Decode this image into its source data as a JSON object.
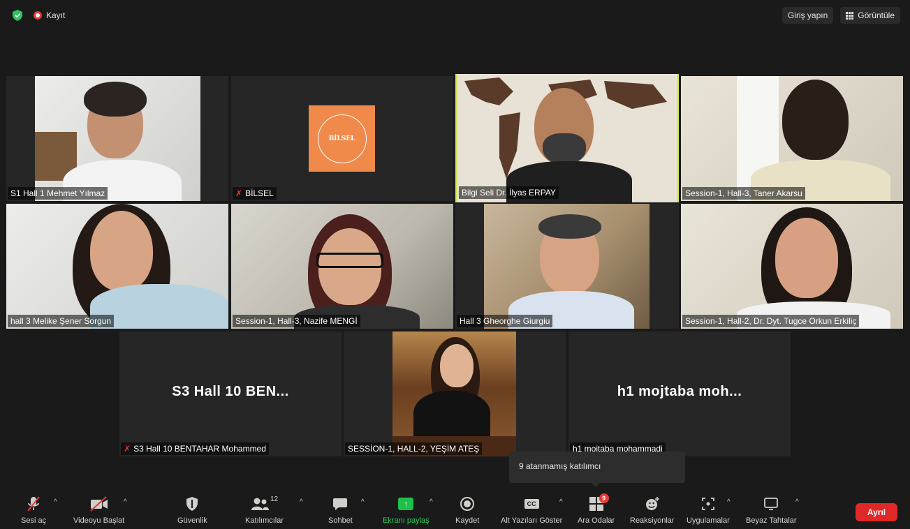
{
  "topbar": {
    "recording_label": "Kayıt",
    "sign_in_label": "Giriş yapın",
    "view_label": "Görüntüle"
  },
  "participants": [
    {
      "name": "S1 Hall 1 Mehmet Yılmaz",
      "muted": false,
      "video": true
    },
    {
      "name": "BİLSEL",
      "muted": true,
      "video": false,
      "logo_text": "BİLSEL"
    },
    {
      "name": "Bilgi Seli Dr. İlyas ERPAY",
      "muted": false,
      "video": true,
      "active_speaker": true
    },
    {
      "name": "Session-1, Hall-3, Taner Akarsu",
      "muted": false,
      "video": true
    },
    {
      "name": "hall 3 Melike Şener Sorgun",
      "muted": false,
      "video": true
    },
    {
      "name": "Session-1, Hall-3, Nazife MENGİ",
      "muted": false,
      "video": true
    },
    {
      "name": "Hall 3 Gheorghe Giurgiu",
      "muted": false,
      "video": true
    },
    {
      "name": "Session-1, Hall-2, Dr. Dyt. Tugce Orkun Erkiliç",
      "muted": false,
      "video": true
    },
    {
      "name": "S3  Hall 10  BENTAHAR Mohammed",
      "muted": true,
      "video": false,
      "display_name": "S3  Hall 10  BEN..."
    },
    {
      "name": "SESSİON-1, HALL-2, YEŞİM ATEŞ",
      "muted": false,
      "video": true
    },
    {
      "name": "h1 mojtaba mohammadi",
      "muted": false,
      "video": false,
      "display_name": "h1 mojtaba moh..."
    }
  ],
  "tooltip": {
    "text": "9 atanmamış katılımcı"
  },
  "toolbar": {
    "unmute": "Sesi aç",
    "start_video": "Videoyu Başlat",
    "security": "Güvenlik",
    "participants": "Katılımcılar",
    "participants_count": "12",
    "chat": "Sohbet",
    "share_screen": "Ekranı paylaş",
    "record": "Kaydet",
    "captions": "Alt Yazıları Göster",
    "captions_icon": "CC",
    "breakout_rooms": "Ara Odalar",
    "breakout_badge": "9",
    "reactions": "Reaksiyonlar",
    "apps": "Uygulamalar",
    "whiteboard": "Beyaz Tahtalar",
    "leave": "Ayrıl"
  },
  "colors": {
    "background": "#1a1a1a",
    "tile": "#262626",
    "active_speaker_border": "#d6e75a",
    "share_green": "#1fbf4c",
    "leave_red": "#e02828",
    "badge_red": "#e53935"
  }
}
